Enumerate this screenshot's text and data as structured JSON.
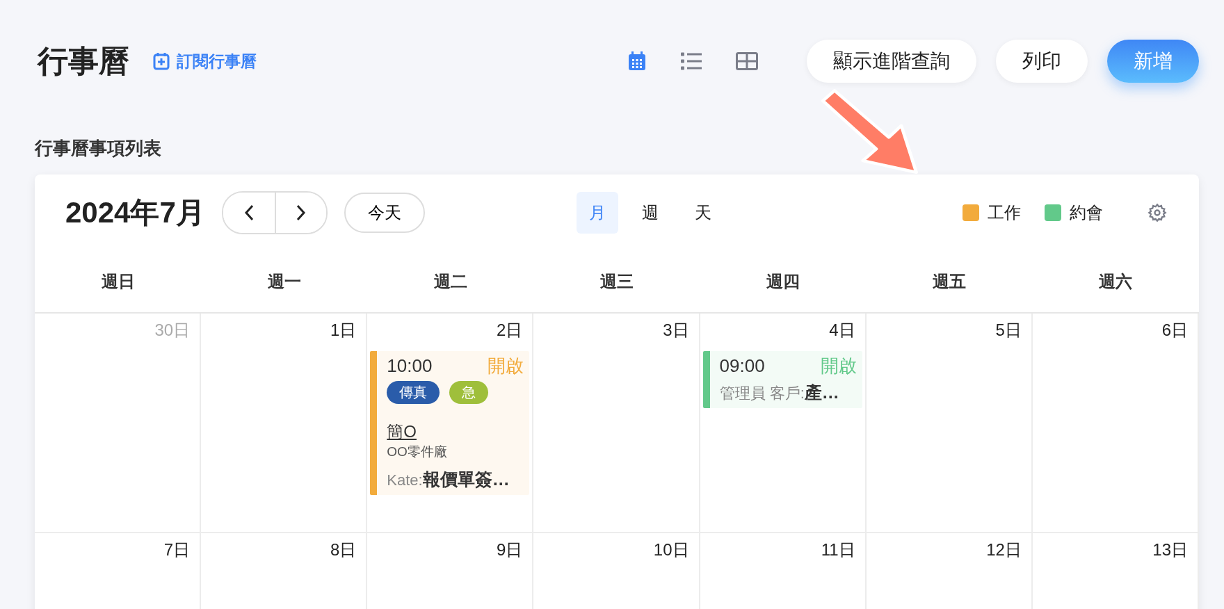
{
  "page": {
    "title": "行事曆",
    "subscribe_link": "訂閱行事曆"
  },
  "view_switch": [
    {
      "kind": "calendar",
      "selected": true
    },
    {
      "kind": "list",
      "selected": false
    },
    {
      "kind": "table",
      "selected": false
    }
  ],
  "buttons": [
    {
      "label": "顯示進階查詢",
      "kind": "default"
    },
    {
      "label": "列印",
      "kind": "default"
    },
    {
      "label": "新增",
      "kind": "primary"
    }
  ],
  "section_title": "行事曆事項列表",
  "calendar": {
    "month_label": "2024年7月",
    "today_button": "今天",
    "views": [
      {
        "label": "月",
        "selected": true
      },
      {
        "label": "週",
        "selected": false
      },
      {
        "label": "天",
        "selected": false
      }
    ],
    "legend": [
      {
        "label": "工作",
        "color": "#f2ab3c"
      },
      {
        "label": "約會",
        "color": "#62c98a"
      }
    ],
    "weekdays": [
      "週日",
      "週一",
      "週二",
      "週三",
      "週四",
      "週五",
      "週六"
    ],
    "weeks": [
      {
        "days": [
          {
            "label": "30日",
            "other_month": true
          },
          {
            "label": "1日",
            "other_month": false
          },
          {
            "label": "2日",
            "other_month": false,
            "events": [
              {
                "time": "10:00",
                "status": "開啟",
                "color": "#f2ab3c",
                "tags": [
                  {
                    "label": "傳真",
                    "color": "#2a5caa"
                  },
                  {
                    "label": "急",
                    "color": "#9fbf3b"
                  }
                ],
                "title": "簡O",
                "company": "OO零件廠",
                "owner": "Kate:",
                "summary": "報價單簽…"
              }
            ]
          },
          {
            "label": "3日",
            "other_month": false
          },
          {
            "label": "4日",
            "other_month": false,
            "events": [
              {
                "time": "09:00",
                "status": "開啟",
                "color": "#62c98a",
                "owner": "管理員 客戶:",
                "summary": "產…"
              }
            ]
          },
          {
            "label": "5日",
            "other_month": false
          },
          {
            "label": "6日",
            "other_month": false
          }
        ]
      },
      {
        "days": [
          {
            "label": "7日",
            "other_month": false
          },
          {
            "label": "8日",
            "other_month": false
          },
          {
            "label": "9日",
            "other_month": false
          },
          {
            "label": "10日",
            "other_month": false
          },
          {
            "label": "11日",
            "other_month": false
          },
          {
            "label": "12日",
            "other_month": false
          },
          {
            "label": "13日",
            "other_month": false
          }
        ]
      }
    ]
  }
}
